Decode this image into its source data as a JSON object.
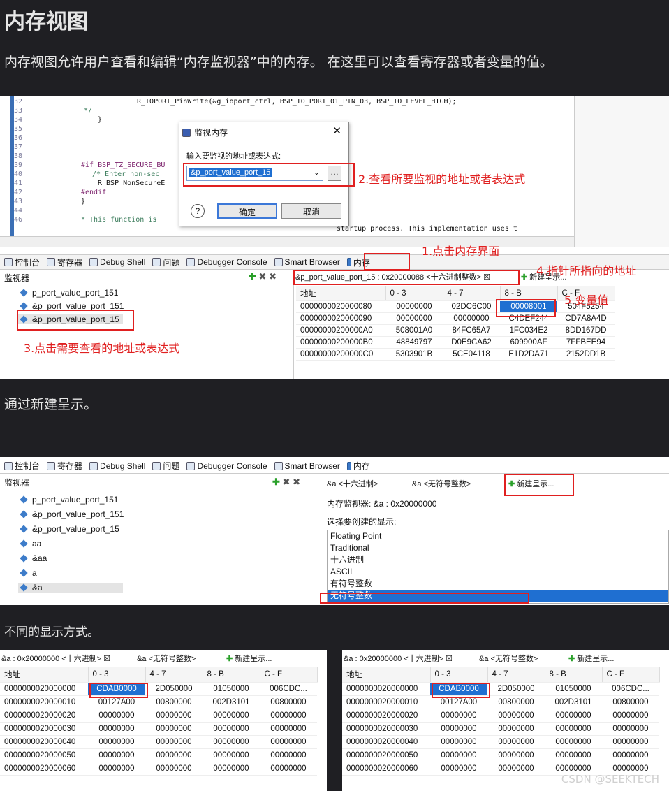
{
  "heading": "内存视图",
  "intro": "内存视图允许用户查看和编辑“内存监视器”中的内存。 在这里可以查看寄存器或者变量的值。",
  "section2_text": "通过新建呈示。",
  "section3_text": "不同的显示方式。",
  "watermark": "CSDN @SEEKTECH",
  "code_lines": [
    {
      "no": "32",
      "text": "R_IOPORT_PinWrite(&g_ioport_ctrl, BSP_IO_PORT_01_PIN_03, BSP_IO_LEVEL_HIGH);",
      "indent": 80
    },
    {
      "no": "33",
      "text": "*/",
      "indent": 4
    },
    {
      "no": "34",
      "text": "}",
      "indent": 24
    },
    {
      "no": "35",
      "text": "",
      "indent": 0
    },
    {
      "no": "36",
      "text": "",
      "indent": 0
    },
    {
      "no": "37",
      "text": "",
      "indent": 0
    },
    {
      "no": "38",
      "text": "",
      "indent": 0
    },
    {
      "no": "39",
      "text": "#if BSP_TZ_SECURE_BU",
      "indent": 0
    },
    {
      "no": "40",
      "text": "/* Enter non-sec",
      "indent": 16
    },
    {
      "no": "41",
      "text": "R_BSP_NonSecureE",
      "indent": 24
    },
    {
      "no": "42",
      "text": "#endif",
      "indent": 0
    },
    {
      "no": "43",
      "text": "}",
      "indent": 0
    },
    {
      "no": "44",
      "text": "",
      "indent": 0
    },
    {
      "no": "46",
      "text": "* This function is",
      "indent": 0
    },
    {
      "no": "",
      "text": "startup process.  This implementation uses t",
      "indent": 366
    }
  ],
  "dialog": {
    "title": "监视内存",
    "prompt": "输入要监视的地址或表达式:",
    "input_value": "&p_port_value_port_15",
    "ok": "确定",
    "cancel": "取消",
    "help": "?"
  },
  "notes": {
    "n1": "1.点击内存界面",
    "n2": "2.查看所要监视的地址或者表达式",
    "n3": "3.点击需要查看的地址或表达式",
    "n4": "4.指针所指向的地址",
    "n5": "5.变量值"
  },
  "tabs": [
    {
      "label": "控制台"
    },
    {
      "label": "寄存器"
    },
    {
      "label": "Debug Shell"
    },
    {
      "label": "问题"
    },
    {
      "label": "Debugger Console"
    },
    {
      "label": "Smart Browser"
    },
    {
      "label": "内存"
    }
  ],
  "monitors_title": "监视器",
  "shot1": {
    "monitors": [
      "p_port_value_port_151",
      "&p_port_value_port_151",
      "&p_port_value_port_15"
    ],
    "rendering_tab": "&p_port_value_port_15 : 0x20000088 <十六进制整数>",
    "new_render": "新建呈示...",
    "headers": [
      "地址",
      "0 - 3",
      "4 - 7",
      "8 - B",
      "C - F"
    ],
    "rows": [
      [
        "0000000020000080",
        "00000000",
        "02DC6C00",
        "00008001",
        "504F5254"
      ],
      [
        "0000000020000090",
        "00000000",
        "00000000",
        "C4DEF244",
        "CD7A8A4D"
      ],
      [
        "00000000200000A0",
        "508001A0",
        "84FC65A7",
        "1FC034E2",
        "8DD167DD"
      ],
      [
        "00000000200000B0",
        "48849797",
        "D0E9CA62",
        "609900AF",
        "7FFBEE94"
      ],
      [
        "00000000200000C0",
        "5303901B",
        "5CE04118",
        "E1D2DA71",
        "2152DD1B"
      ]
    ]
  },
  "shot2": {
    "monitors": [
      "p_port_value_port_151",
      "&p_port_value_port_151",
      "&p_port_value_port_15",
      "aa",
      "&aa",
      "a",
      "&a"
    ],
    "tab_hex": "&a <十六进制>",
    "tab_unsigned": "&a <无符号整数>",
    "new_render": "新建呈示...",
    "monitor_label": "内存监视器:  &a : 0x20000000",
    "choose_label": "选择要创建的显示:",
    "options": [
      "Floating Point",
      "Traditional",
      "十六进制",
      "ASCII",
      "有符号整数",
      "无符号整数"
    ]
  },
  "shot3": {
    "tab_hex": "&a : 0x20000000 <十六进制>",
    "tab_unsigned": "&a <无符号整数>",
    "new_render": "新建呈示...",
    "headers": [
      "地址",
      "0 - 3",
      "4 - 7",
      "8 - B",
      "C - F"
    ],
    "rows": [
      [
        "0000000020000000",
        "CDAB0000",
        "2D050000",
        "01050000",
        "006CDC..."
      ],
      [
        "0000000020000010",
        "00127A00",
        "00800000",
        "002D3101",
        "00800000"
      ],
      [
        "0000000020000020",
        "00000000",
        "00000000",
        "00000000",
        "00000000"
      ],
      [
        "0000000020000030",
        "00000000",
        "00000000",
        "00000000",
        "00000000"
      ],
      [
        "0000000020000040",
        "00000000",
        "00000000",
        "00000000",
        "00000000"
      ],
      [
        "0000000020000050",
        "00000000",
        "00000000",
        "00000000",
        "00000000"
      ],
      [
        "0000000020000060",
        "00000000",
        "00000000",
        "00000000",
        "00000000"
      ]
    ]
  },
  "colors": {
    "page_bg": "#1f1f23",
    "annotation": "#e02020",
    "selection": "#1f6fd1"
  }
}
